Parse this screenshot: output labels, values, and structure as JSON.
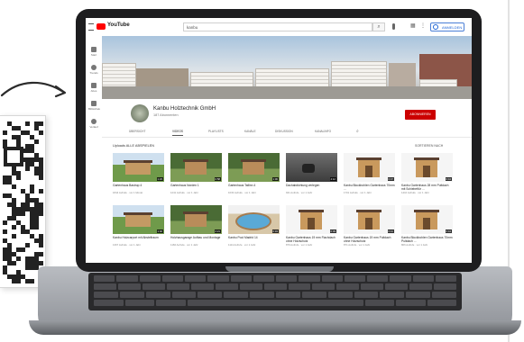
{
  "youtube": {
    "logo_text": "YouTube",
    "search_value": "kanbu",
    "search_icon": "search-icon",
    "signin_label": "ANMELDEN",
    "sidebar": [
      "Start",
      "Trends",
      "Abos",
      "Bibliothek",
      "Verlauf"
    ],
    "channel": {
      "name": "Kanbu Holztechnik GmbH",
      "subscribers": "187 Abonnenten",
      "subscribe_label": "ABONNIEREN"
    },
    "tabs": [
      "ÜBERSICHT",
      "VIDEOS",
      "PLAYLISTS",
      "KANÄLE",
      "DISKUSSION",
      "KANALINFO"
    ],
    "uploads_label": "Uploads   ALLE ABSPIELEN",
    "sort_label": "SORTIEREN NACH",
    "videos": [
      {
        "title": "Gartenhaus Bastrup 4",
        "meta": "1844 Aufrufe · vor 1 Monat",
        "duration": "1:23",
        "kind": "house-lawn"
      },
      {
        "title": "Gartenhaus Norden 1",
        "meta": "1241 Aufrufe · vor 1 Jahr",
        "duration": "0:58",
        "kind": "house-trees"
      },
      {
        "title": "Gartenhaus Tallinn 4",
        "meta": "1033 Aufrufe · vor 1 Jahr",
        "duration": "1:06",
        "kind": "house-trees"
      },
      {
        "title": "Dachabdichtung verlegen",
        "meta": "941 Aufrufe · vor 1 Jahr",
        "duration": "4:12",
        "kind": "worker"
      },
      {
        "title": "Kanbu Blockbohlen Gartenhaus 70mm ...",
        "meta": "1701 Aufrufe · vor 1 Jahr",
        "duration": "0:47",
        "kind": "render"
      },
      {
        "title": "Kanbu Gartenhaus 28 mm Pultdach mit Schiebeftür ...",
        "meta": "1410 Aufrufe · vor 1 Jahr",
        "duration": "0:44",
        "kind": "render"
      },
      {
        "title": "Kanbu Holzcarport mit Abstellraum",
        "meta": "1367 Aufrufe · vor 1 Jahr",
        "duration": "1:02",
        "kind": "house-lawn"
      },
      {
        "title": "Holzhausgarage Aufbau und Montage",
        "meta": "1166 Aufrufe · vor 1 Jahr",
        "duration": "2:21",
        "kind": "house-trees"
      },
      {
        "title": "Kanbu Pool Madrid 14",
        "meta": "1114 Aufrufe · vor 1 Jahr",
        "duration": "0:34",
        "kind": "pool"
      },
      {
        "title": "Kanbu Gartenhaus 19 mm Flachdach ohne Holzschutz",
        "meta": "879 Aufrufe · vor 1 Jahr",
        "duration": "0:39",
        "kind": "render"
      },
      {
        "title": "Kanbu Gartenhaus 19 mm Pultdach ohne Holzschutz",
        "meta": "871 Aufrufe · vor 1 Jahr",
        "duration": "0:41",
        "kind": "render"
      },
      {
        "title": "Kanbu Blockbohlen Gartenhaus 70mm Pultdach ...",
        "meta": "806 Aufrufe · vor 1 Jahr",
        "duration": "0:44",
        "kind": "render"
      }
    ]
  }
}
